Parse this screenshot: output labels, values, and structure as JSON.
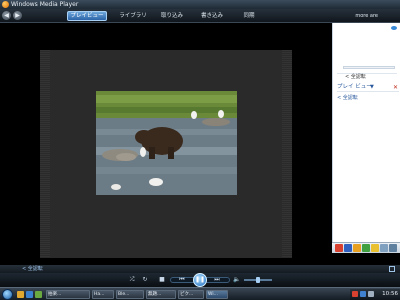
{
  "window": {
    "title": "Windows Media Player"
  },
  "nav": {
    "back_glyph": "◀",
    "forward_glyph": "▶",
    "tabs": [
      {
        "label": "プレイビュー",
        "active": true
      },
      {
        "label": "ライブラリ",
        "active": false
      },
      {
        "label": "取り込み",
        "active": false
      },
      {
        "label": "書き込み",
        "active": false
      },
      {
        "label": "同期",
        "active": false
      }
    ],
    "user_label": "more are"
  },
  "playlist_pane": {
    "back_label": "< 全認転",
    "title": "プレイ ビュー",
    "chevron": "▼",
    "close_glyph": "✕",
    "back_label_2": "< 全認転"
  },
  "info_bar": {
    "text": "< 全認転"
  },
  "controls": {
    "shuffle_glyph": "⤮",
    "repeat_glyph": "↻",
    "stop_glyph": "■",
    "previous_glyph": "⏮",
    "play_glyph": "❚❚",
    "next_glyph": "⏭",
    "mute_glyph": "🔈",
    "volume_level": 0.5
  },
  "taskbar": {
    "tasks": [
      "拍楽...",
      "Ha...",
      "Ble...",
      "無題...",
      "ピク...",
      "Wi..."
    ],
    "clock": "10:56"
  },
  "colors": {
    "accent": "#2c64a8",
    "tab_active": "#6ea8dc",
    "link": "#2a5a9c"
  }
}
